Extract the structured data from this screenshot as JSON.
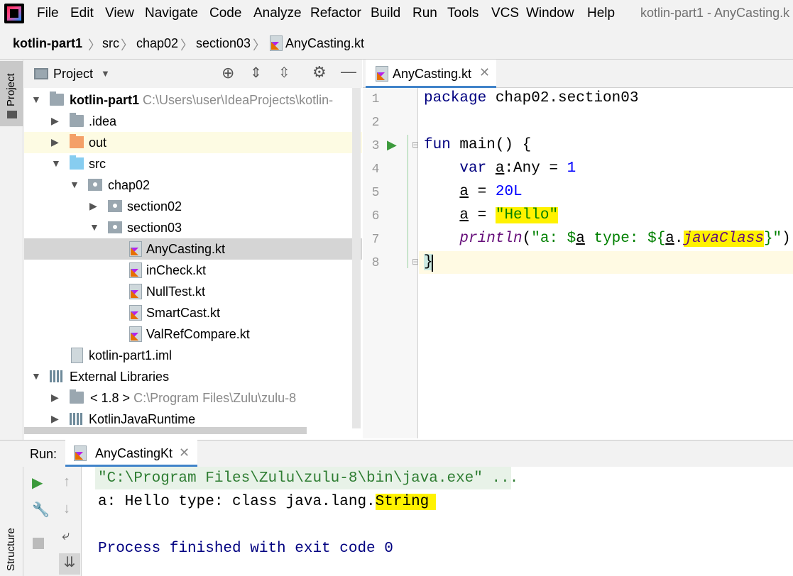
{
  "menubar": {
    "items": [
      "File",
      "Edit",
      "View",
      "Navigate",
      "Code",
      "Analyze",
      "Refactor",
      "Build",
      "Run",
      "Tools",
      "VCS",
      "Window",
      "Help"
    ],
    "window_title": "kotlin-part1 - AnyCasting.k"
  },
  "breadcrumb": [
    "kotlin-part1",
    "src",
    "chap02",
    "section03",
    "AnyCasting.kt"
  ],
  "side_tabs": {
    "project": "Project",
    "structure": "Structure"
  },
  "project_panel": {
    "title": "Project",
    "tree": [
      {
        "label": "kotlin-part1",
        "path": "C:\\Users\\user\\IdeaProjects\\kotlin-"
      },
      {
        "label": ".idea"
      },
      {
        "label": "out"
      },
      {
        "label": "src"
      },
      {
        "label": "chap02"
      },
      {
        "label": "section02"
      },
      {
        "label": "section03"
      },
      {
        "label": "AnyCasting.kt"
      },
      {
        "label": "inCheck.kt"
      },
      {
        "label": "NullTest.kt"
      },
      {
        "label": "SmartCast.kt"
      },
      {
        "label": "ValRefCompare.kt"
      },
      {
        "label": "kotlin-part1.iml"
      },
      {
        "label": "External Libraries"
      },
      {
        "label": "< 1.8 >",
        "path": "C:\\Program Files\\Zulu\\zulu-8"
      },
      {
        "label": "KotlinJavaRuntime"
      }
    ]
  },
  "editor": {
    "tab_label": "AnyCasting.kt",
    "line_numbers": [
      "1",
      "2",
      "3",
      "4",
      "5",
      "6",
      "7",
      "8"
    ],
    "code": {
      "l1_kw": "package",
      "l1_rest": " chap02.section03",
      "l3_kw": "fun",
      "l3_rest": " main() {",
      "l4_kw": "var",
      "l4_var": "a",
      "l4_rest": ":Any = ",
      "l4_num": "1",
      "l5_var": "a",
      "l5_rest": " = ",
      "l5_num": "20L",
      "l6_var": "a",
      "l6_rest": " = ",
      "l6_str": "\"Hello\"",
      "l7_fn": "println",
      "l7_open": "(",
      "l7_str1": "\"a: $",
      "l7_var1": "a",
      "l7_str2": " type: ${",
      "l7_var2": "a",
      "l7_dot": ".",
      "l7_prop": "javaClass",
      "l7_str3": "}\"",
      "l7_close": ")",
      "l8": "}"
    }
  },
  "run_panel": {
    "label": "Run:",
    "tab": "AnyCastingKt",
    "output": {
      "cmd": "\"C:\\Program Files\\Zulu\\zulu-8\\bin\\java.exe\" ...",
      "line1_prefix": "a: Hello type: class java.lang.",
      "line1_hl": "String",
      "exit": "Process finished with exit code 0"
    }
  }
}
